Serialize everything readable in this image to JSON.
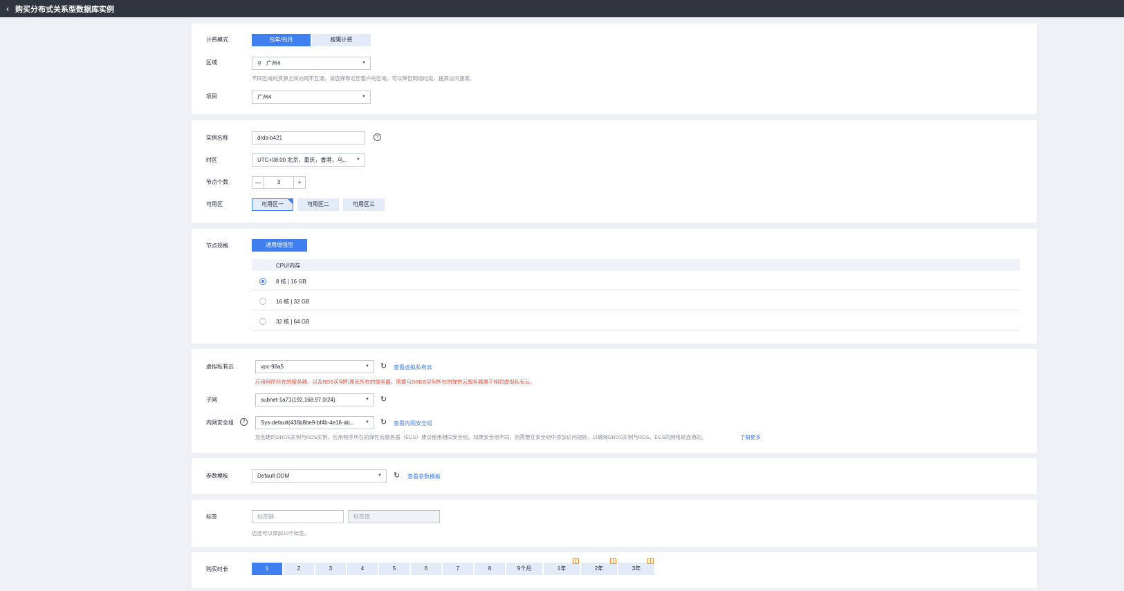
{
  "header": {
    "back_icon": "‹",
    "title": "购买分布式关系型数据库实例"
  },
  "billing": {
    "mode_label": "计费模式",
    "modes": [
      "包年/包月",
      "按需计费"
    ],
    "selected_mode": "包年/包月",
    "region_label": "区域",
    "region_value": "广州4",
    "region_hint": "不同区域的资源之间内网不互通。请选择靠近您客户的区域，可以降低网络时延、提高访问速度。",
    "project_label": "项目",
    "project_value": "广州4"
  },
  "instance": {
    "name_label": "实例名称",
    "name_value": "drds-b421",
    "timezone_label": "时区",
    "timezone_value": "UTC+08:00 北京，重庆，香港，乌...",
    "nodes_label": "节点个数",
    "nodes_value": "3",
    "minus": "—",
    "plus": "+",
    "az_label": "可用区",
    "zones": [
      "可用区一",
      "可用区二",
      "可用区三"
    ],
    "selected_zone": "可用区一"
  },
  "spec": {
    "label": "节点规格",
    "type_button": "通用增强型",
    "column_header": "CPU/内存",
    "rows": [
      "8 核 | 16 GB",
      "16 核 | 32 GB",
      "32 核 | 64 GB"
    ],
    "selected_row": "8 核 | 16 GB"
  },
  "network": {
    "vpc_label": "虚拟私有云",
    "vpc_value": "vpc-98a5",
    "vpc_link": "查看虚拟私有云",
    "vpc_warning": "应用程序所在的服务器、以及RDS实例所理库所在的服务器，需要与DRDS实例所在的弹性云服务器属于相同虚拟私有云。",
    "subnet_label": "子网",
    "subnet_value": "subnet-1a71(192.168.97.0/24)",
    "sg_label": "内网安全组",
    "sg_value": "Sys-default(436b8be9-bf4b-4e16-ab...",
    "sg_link": "查看内网安全组",
    "sg_hint": "您创建的DRDS实例与RDS实例、应用程序所在的弹性云服务器（ECS）建议使用相同安全组。如果安全组不同，则需要在安全组中添加访问规则，以确保DRDS实例与RDS、ECS的网络是连通的。",
    "sg_more": "了解更多"
  },
  "params": {
    "label": "参数模板",
    "value": "Default-DDM",
    "link": "查看参数模板"
  },
  "tags": {
    "label": "标签",
    "key_placeholder": "标签键",
    "value_placeholder": "标签值",
    "hint": "您还可以添加10个标签。"
  },
  "duration": {
    "label": "购买时长",
    "options": [
      "1",
      "2",
      "3",
      "4",
      "5",
      "6",
      "7",
      "8",
      "9个月",
      "1年",
      "2年",
      "3年"
    ],
    "selected": "1"
  },
  "icons": {
    "location": "location-pin-icon",
    "help": "question-circle-icon",
    "refresh": "refresh-icon",
    "caret": "caret-down-icon",
    "gift": "gift-icon"
  },
  "colors": {
    "primary": "#3f7fef",
    "warning": "#e84c3d",
    "header_bg": "#303540"
  }
}
